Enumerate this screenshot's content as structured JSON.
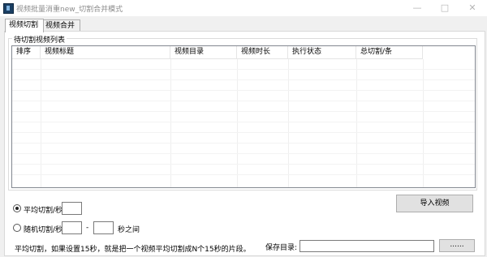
{
  "window": {
    "title": "视频批量消重new_切割合并模式",
    "minimize": "—",
    "maximize": "□",
    "close": "✕"
  },
  "tabs": [
    {
      "label": "视频切割",
      "active": true
    },
    {
      "label": "视频合并",
      "active": false
    }
  ],
  "group": {
    "legend": "待切割视频列表"
  },
  "table": {
    "columns": [
      "排序",
      "视频标题",
      "视频目录",
      "视频时长",
      "执行状态",
      "总切割/条"
    ],
    "rows": []
  },
  "options": {
    "average_label": "平均切割/秒",
    "average_value": "",
    "random_label": "随机切割/秒",
    "random_min": "",
    "random_separator": "-",
    "random_max": "",
    "random_suffix": "秒之间",
    "selected": "average"
  },
  "import_button": "导入视频",
  "hint": "平均切割，如果设置15秒，就是把一个视频平均切割成N个15秒的片段。",
  "save": {
    "label": "保存目录:",
    "value": "",
    "browse_label": "......"
  }
}
